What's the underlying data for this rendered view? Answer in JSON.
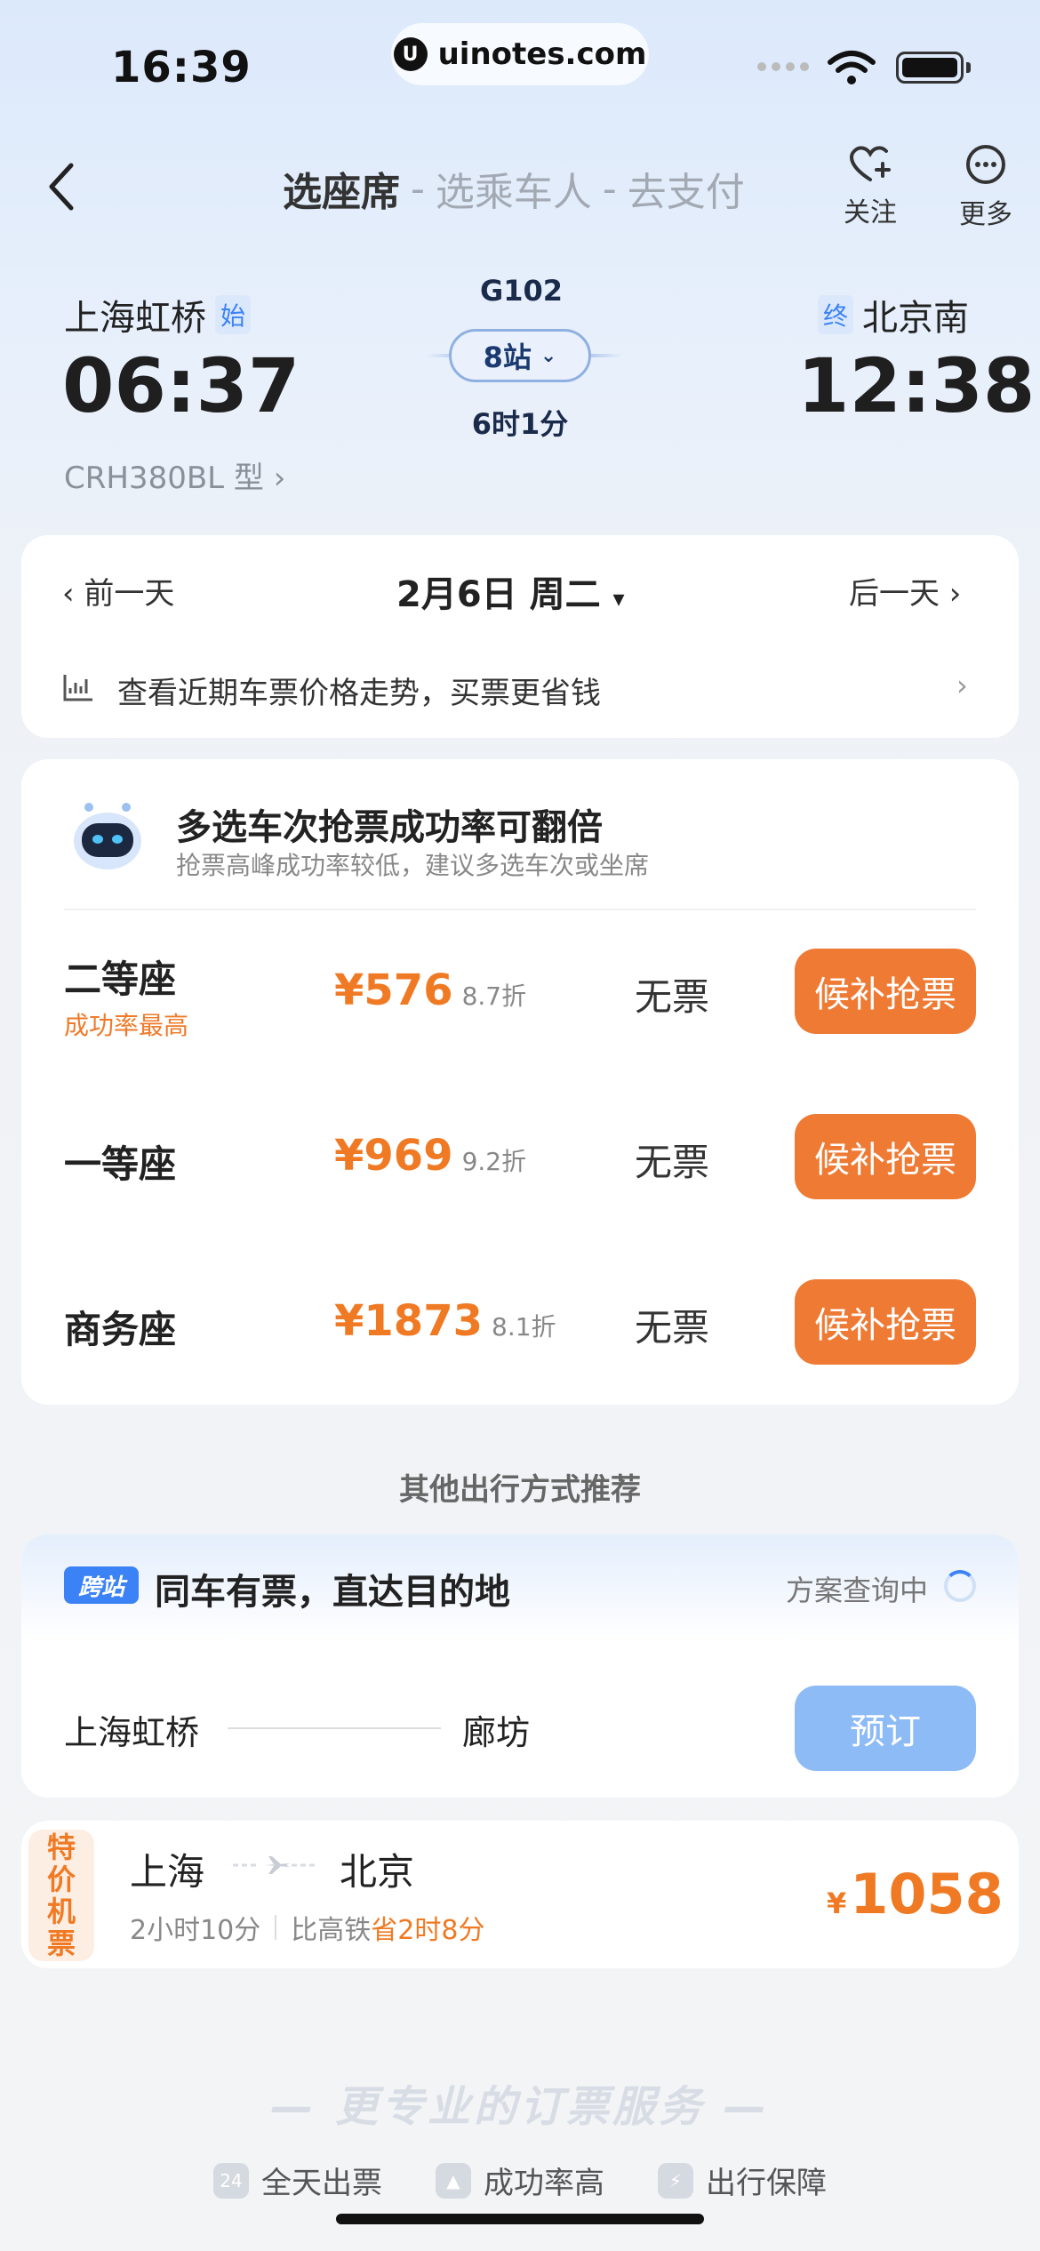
{
  "status_bar": {
    "time": "16:39",
    "url": "uinotes.com"
  },
  "nav": {
    "steps": [
      "选座席",
      "选乘车人",
      "去支付"
    ],
    "follow_label": "关注",
    "more_label": "更多"
  },
  "train": {
    "from_station": "上海虹桥",
    "from_tag": "始",
    "depart_time": "06:37",
    "train_no": "G102",
    "stops": "8站",
    "duration": "6时1分",
    "to_station": "北京南",
    "to_tag": "终",
    "arrive_time": "12:38",
    "model": "CRH380BL 型 ›"
  },
  "date_bar": {
    "prev": "前一天",
    "current": "2月6日 周二",
    "next": "后一天",
    "trend_text": "查看近期车票价格走势，买票更省钱"
  },
  "seat_tip": {
    "title": "多选车次抢票成功率可翻倍",
    "subtitle": "抢票高峰成功率较低，建议多选车次或坐席"
  },
  "seats": [
    {
      "name": "二等座",
      "tag": "成功率最高",
      "price": "¥576",
      "discount": "8.7折",
      "availability": "无票",
      "button": "候补抢票"
    },
    {
      "name": "一等座",
      "tag": "",
      "price": "¥969",
      "discount": "9.2折",
      "availability": "无票",
      "button": "候补抢票"
    },
    {
      "name": "商务座",
      "tag": "",
      "price": "¥1873",
      "discount": "8.1折",
      "availability": "无票",
      "button": "候补抢票"
    }
  ],
  "other_title": "其他出行方式推荐",
  "cross_station": {
    "badge": "跨站",
    "title": "同车有票，直达目的地",
    "status": "方案查询中",
    "from": "上海虹桥",
    "to": "廊坊",
    "button": "预订"
  },
  "flight": {
    "badge_chars": [
      "特",
      "价",
      "机",
      "票"
    ],
    "from": "上海",
    "to": "北京",
    "duration": "2小时10分",
    "compare_prefix": "比高铁",
    "compare_highlight": "省2时8分",
    "currency": "¥",
    "price": "1058"
  },
  "service": {
    "title": "— 更专业的订票服务 —",
    "items": [
      "全天出票",
      "成功率高",
      "出行保障"
    ]
  },
  "colors": {
    "accent_orange": "#ee7a33",
    "accent_blue": "#3b82f6",
    "button_blue_disabled": "#8dbbf5"
  }
}
